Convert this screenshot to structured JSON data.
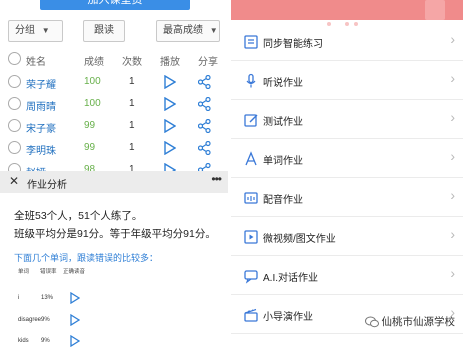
{
  "left": {
    "top_button": "加入课堂资",
    "filters": {
      "group": "分组",
      "follow": "跟读",
      "best_score": "最高成绩"
    },
    "header": {
      "name": "姓名",
      "score": "成绩",
      "count": "次数",
      "play": "播放",
      "share": "分享"
    },
    "students": [
      {
        "name": "荣子耀",
        "score": "100",
        "count": "1"
      },
      {
        "name": "周雨晴",
        "score": "100",
        "count": "1"
      },
      {
        "name": "宋子豪",
        "score": "99",
        "count": "1"
      },
      {
        "name": "李明珠",
        "score": "99",
        "count": "1"
      },
      {
        "name": "赵娅",
        "score": "98",
        "count": "1"
      }
    ],
    "analysis": {
      "title": "作业分析",
      "summary_1": "全班53个人，51个人练了。",
      "summary_2": "班级平均分是91分。等于年级平均分91分。",
      "hint": "下面几个单词，跟读错误的比较多：",
      "word_columns": {
        "word": "单词",
        "error_rate": "错误率",
        "correct_pron": "正确读音"
      },
      "words": [
        {
          "word": "i",
          "rate": "13%"
        },
        {
          "word": "disagree",
          "rate": "9%"
        },
        {
          "word": "kids",
          "rate": "9%"
        }
      ]
    }
  },
  "right": {
    "menu": [
      {
        "label": "同步智能练习",
        "icon": "book-icon"
      },
      {
        "label": "听说作业",
        "icon": "microphone-icon"
      },
      {
        "label": "测试作业",
        "icon": "edit-icon"
      },
      {
        "label": "单词作业",
        "icon": "letter-a-icon"
      },
      {
        "label": "配音作业",
        "icon": "dubbing-icon"
      },
      {
        "label": "微视频/图文作业",
        "icon": "video-icon"
      },
      {
        "label": "A.I.对话作业",
        "icon": "chat-icon"
      },
      {
        "label": "小导演作业",
        "icon": "director-icon"
      }
    ],
    "watermark": "仙桃市仙源学校"
  },
  "colors": {
    "accent_blue": "#2f7fd6",
    "score_green": "#67b04a",
    "banner_red": "#f08b8b",
    "icon_blue": "#3a78d8"
  }
}
